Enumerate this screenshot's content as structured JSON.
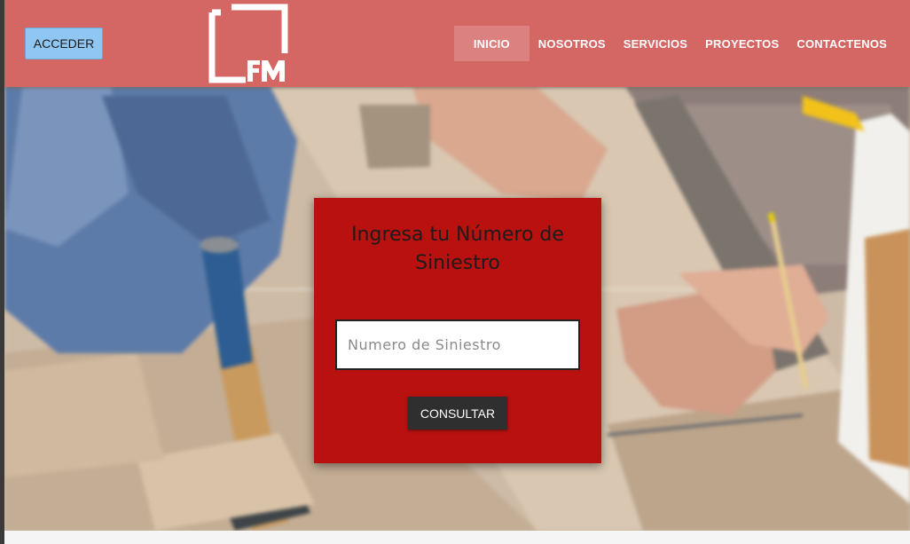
{
  "header": {
    "login_button": "ACCEDER",
    "logo_text": "FM",
    "nav": [
      {
        "label": "INICIO",
        "active": true
      },
      {
        "label": "NOSOTROS",
        "active": false
      },
      {
        "label": "SERVICIOS",
        "active": false
      },
      {
        "label": "PROYECTOS",
        "active": false
      },
      {
        "label": "CONTACTENOS",
        "active": false
      }
    ],
    "colors": {
      "header_bg": "#d46663",
      "login_bg": "#8fc6f2"
    }
  },
  "hero": {
    "background": "blurred photo of carpenter installing wood floor with hammer and pencil"
  },
  "claim_card": {
    "title": "Ingresa tu Número de Siniestro",
    "input_value": "",
    "input_placeholder": "Numero de Siniestro",
    "submit_label": "CONSULTAR",
    "colors": {
      "card_bg": "#b8110f",
      "button_bg": "#2f2f2f"
    }
  }
}
